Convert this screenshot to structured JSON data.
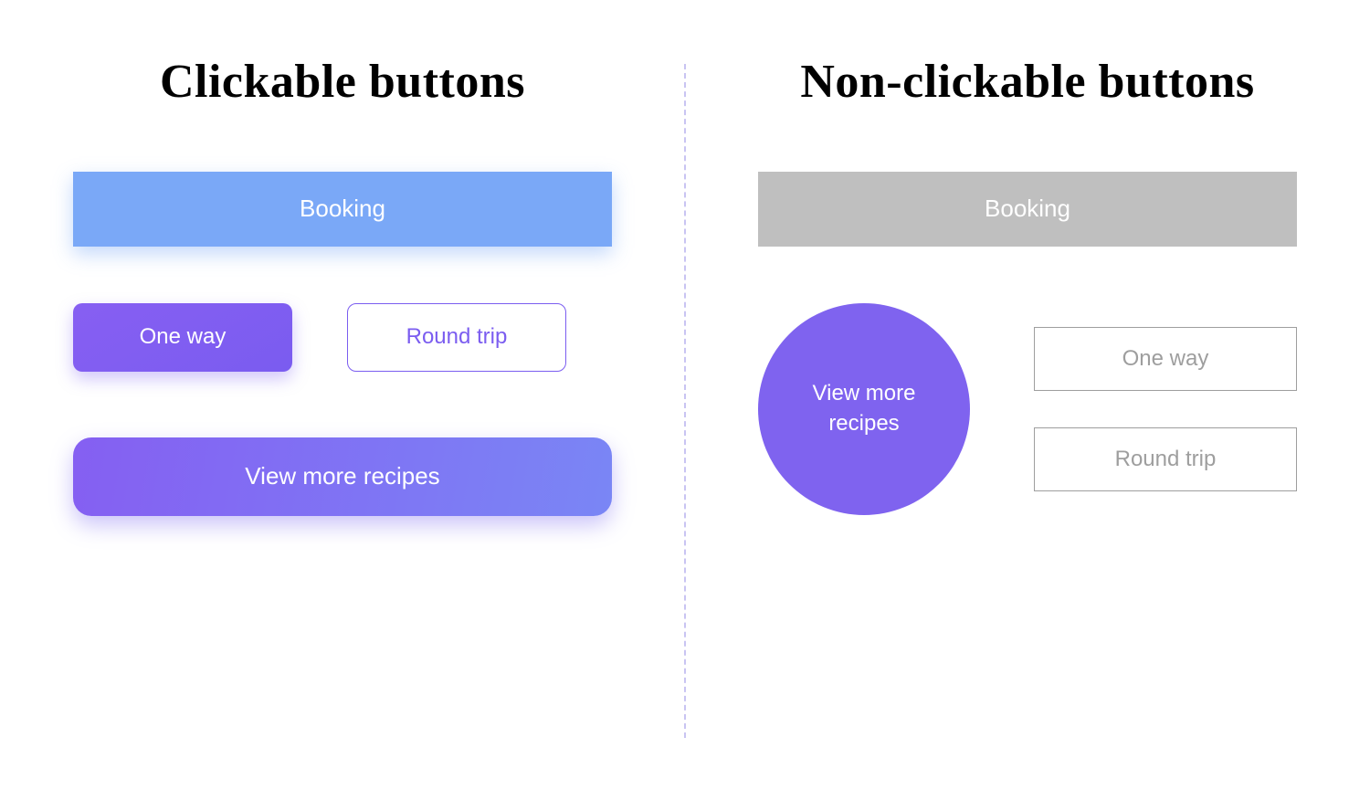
{
  "left": {
    "heading": "Clickable buttons",
    "booking": "Booking",
    "one_way": "One way",
    "round_trip": "Round trip",
    "view_more": "View more recipes"
  },
  "right": {
    "heading": "Non-clickable buttons",
    "booking": "Booking",
    "view_more": "View more recipes",
    "one_way": "One way",
    "round_trip": "Round trip"
  },
  "colors": {
    "blue": "#7aa8f7",
    "purple": "#7b5df0",
    "purple_gradient_start": "#855ff2",
    "purple_gradient_end": "#7a86f5",
    "gray": "#bfbfbf",
    "gray_text": "#9e9e9e",
    "divider": "#c9c4f2"
  }
}
